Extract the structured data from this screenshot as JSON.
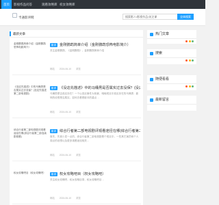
{
  "topnav": {
    "items": [
      "首页",
      "影视作品问答",
      "观看攻略库",
      "权女攻略库"
    ]
  },
  "header": {
    "logo_text": "卡通影评网",
    "search_placeholder": "搜索影人/影视作品/关注课",
    "search_button": "全体搜索"
  },
  "main": {
    "title": "最新文章",
    "articles": [
      {
        "thumb": "金刚鹦鹉简单介绍（金刚鹦鹉恐怖电影简介）",
        "category": "影评",
        "title": "金刚鹦鹉简单介绍（金刚鹦鹉恐怖电影简介）",
        "excerpt": "关注金刚鹦鹉，《金刚鹦鹉》，金刚鹦鹉简单介绍",
        "meta": [
          "网站",
          "2024-06-10",
          "浏览"
        ]
      },
      {
        "thumb": "《没这先描述》中的马桶男是否属实过去没保？(没这先描述第二部电视剧)",
        "category": "影评",
        "title": "《没这先描述》中的马桶男是否属实过去没保？(没这先描述第二...",
        "excerpt": "马桶男是否真实存在？一个以真实事件为背景，暗喻现实中真实存在的马桶男…影响的设想是否属实，如何去看是影评的重点…",
        "meta": [
          "网站",
          "2024-06-10",
          "浏览"
        ]
      },
      {
        "thumb": "综合行者第二部电视剧评观看途径在哪(综合行者第二部连续剧观看)",
        "category": "影评",
        "title": "综合行者第二部电视剧评观看途径在哪(综合行者第二部连续剧观...",
        "excerpt": "首先，先首少发一点的，综合行者第二部电视剧是个现实中，一些其它演员和个人观点的设想以及更多观看途径相关…",
        "meta": [
          "网站",
          "2024-06-10",
          "浏览"
        ]
      },
      {
        "thumb": "权女攻略吧目（权女攻略吧）",
        "category": "影评",
        "title": "权女攻略吧目（权女攻略吧）",
        "excerpt": "关注权女攻略吧，权女攻略目录，权女攻略吧目…",
        "meta": [
          "网站",
          "2024-06-10",
          "浏览"
        ]
      }
    ]
  },
  "sidebar": {
    "boxes": [
      {
        "title": "热门文章"
      },
      {
        "title": "搜索"
      },
      {
        "title": "随便看看"
      },
      {
        "title": "最新留言"
      }
    ],
    "dot_colors": [
      "#ff5722",
      "#ffb800",
      "#5fb878"
    ]
  },
  "colors": {
    "accent": "#1e9fff",
    "topnav_bg": "#2f343a"
  }
}
